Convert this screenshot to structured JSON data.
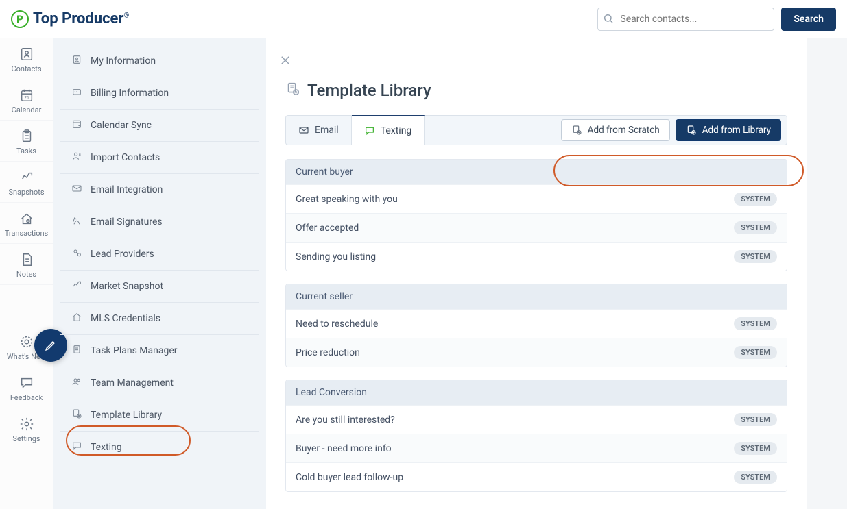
{
  "brand": {
    "name": "Top Producer",
    "mark": "P"
  },
  "search": {
    "placeholder": "Search contacts...",
    "button": "Search"
  },
  "rail": [
    {
      "key": "contacts",
      "label": "Contacts"
    },
    {
      "key": "calendar",
      "label": "Calendar",
      "badge": "26"
    },
    {
      "key": "tasks",
      "label": "Tasks"
    },
    {
      "key": "snapshots",
      "label": "Snapshots"
    },
    {
      "key": "transactions",
      "label": "Transactions"
    },
    {
      "key": "notes",
      "label": "Notes"
    },
    {
      "key": "whatsnew",
      "label": "What's New"
    },
    {
      "key": "feedback",
      "label": "Feedback"
    },
    {
      "key": "settings",
      "label": "Settings"
    }
  ],
  "sidebar": {
    "items": [
      "My Information",
      "Billing Information",
      "Calendar Sync",
      "Import Contacts",
      "Email Integration",
      "Email Signatures",
      "Lead Providers",
      "Market Snapshot",
      "MLS Credentials",
      "Task Plans Manager",
      "Team Management",
      "Template Library",
      "Texting"
    ],
    "highlight_index": 11
  },
  "page": {
    "title": "Template Library",
    "tabs": {
      "email": "Email",
      "texting": "Texting",
      "active": "texting"
    },
    "actions": {
      "scratch": "Add from Scratch",
      "library": "Add from Library"
    },
    "sections": [
      {
        "title": "Current buyer",
        "rows": [
          {
            "name": "Great speaking with you",
            "tag": "SYSTEM"
          },
          {
            "name": "Offer accepted",
            "tag": "SYSTEM"
          },
          {
            "name": "Sending you listing",
            "tag": "SYSTEM"
          }
        ]
      },
      {
        "title": "Current seller",
        "rows": [
          {
            "name": "Need to reschedule",
            "tag": "SYSTEM"
          },
          {
            "name": "Price reduction",
            "tag": "SYSTEM"
          }
        ]
      },
      {
        "title": "Lead Conversion",
        "rows": [
          {
            "name": "Are you still interested?",
            "tag": "SYSTEM"
          },
          {
            "name": "Buyer - need more info",
            "tag": "SYSTEM"
          },
          {
            "name": "Cold buyer lead follow-up",
            "tag": "SYSTEM"
          }
        ]
      }
    ]
  }
}
